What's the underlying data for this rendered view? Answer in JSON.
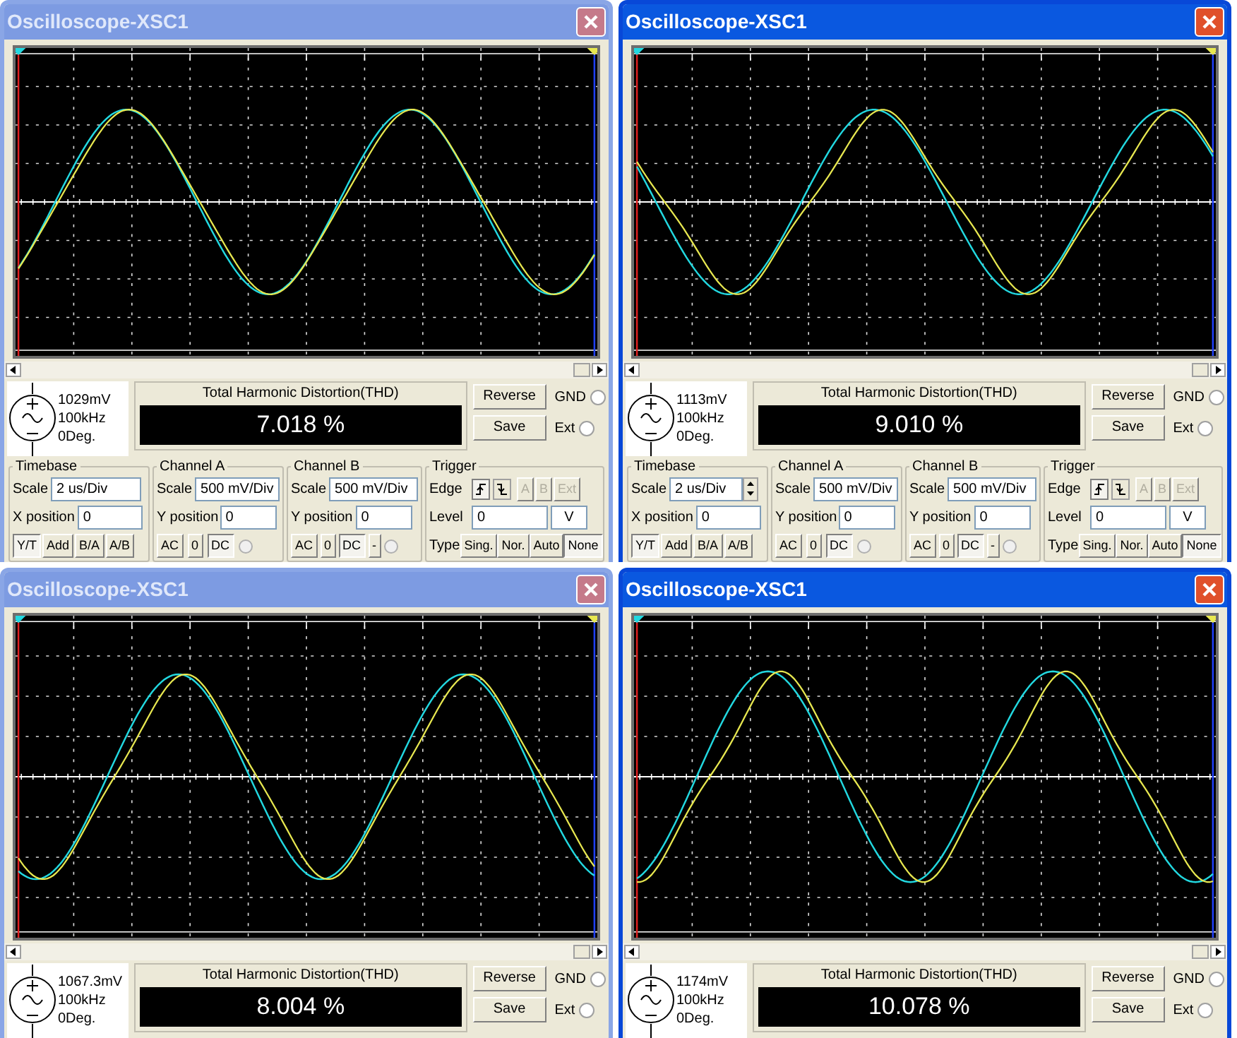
{
  "windows": [
    {
      "title": "Oscilloscope-XSC1",
      "active": false,
      "generator": {
        "amplitude": "1029mV",
        "frequency": "100kHz",
        "phase": "0Deg."
      },
      "thd_label": "Total Harmonic Distortion(THD)",
      "thd_value": "7.018 %",
      "buttons": [
        "Reverse",
        "Save"
      ],
      "radios": [
        {
          "label": "GND",
          "selected": false
        },
        {
          "label": "Ext",
          "selected": false
        }
      ],
      "controls": {
        "timebase": {
          "title": "Timebase",
          "scale_label": "Scale",
          "scale": "2 us/Div",
          "spinner": false,
          "xpos_label": "X position",
          "xpos": "0",
          "modes": [
            {
              "label": "Y/T",
              "selected": true
            },
            {
              "label": "Add",
              "selected": false
            },
            {
              "label": "B/A",
              "selected": false
            },
            {
              "label": "A/B",
              "selected": false
            }
          ]
        },
        "channel_a": {
          "title": "Channel A",
          "scale_label": "Scale",
          "scale": "500 mV/Div",
          "ypos_label": "Y position",
          "ypos": "0",
          "coupling": [
            {
              "label": "AC",
              "selected": false
            },
            {
              "label": "0",
              "selected": false
            },
            {
              "label": "DC",
              "selected": true
            }
          ]
        },
        "channel_b": {
          "title": "Channel B",
          "scale_label": "Scale",
          "scale": "500 mV/Div",
          "ypos_label": "Y position",
          "ypos": "0",
          "coupling": [
            {
              "label": "AC",
              "selected": false
            },
            {
              "label": "0",
              "selected": false
            },
            {
              "label": "DC",
              "selected": true
            },
            {
              "label": "-",
              "selected": false
            }
          ]
        },
        "trigger": {
          "title": "Trigger",
          "edge_label": "Edge",
          "sources": [
            {
              "label": "A",
              "disabled": true
            },
            {
              "label": "B",
              "disabled": true
            },
            {
              "label": "Ext",
              "disabled": true
            }
          ],
          "level_label": "Level",
          "level": "0",
          "unit": "V",
          "type_label": "Type",
          "types": [
            {
              "label": "Sing.",
              "selected": false
            },
            {
              "label": "Nor.",
              "selected": false
            },
            {
              "label": "Auto",
              "selected": false
            },
            {
              "label": "None",
              "selected": true
            }
          ]
        }
      }
    },
    {
      "title": "Oscilloscope-XSC1",
      "active": true,
      "generator": {
        "amplitude": "1113mV",
        "frequency": "100kHz",
        "phase": "0Deg."
      },
      "thd_label": "Total Harmonic Distortion(THD)",
      "thd_value": "9.010 %",
      "buttons": [
        "Reverse",
        "Save"
      ],
      "radios": [
        {
          "label": "GND",
          "selected": false
        },
        {
          "label": "Ext",
          "selected": false
        }
      ],
      "controls": {
        "timebase": {
          "title": "Timebase",
          "scale_label": "Scale",
          "scale": "2 us/Div",
          "spinner": true,
          "xpos_label": "X position",
          "xpos": "0",
          "modes": [
            {
              "label": "Y/T",
              "selected": true
            },
            {
              "label": "Add",
              "selected": false
            },
            {
              "label": "B/A",
              "selected": false
            },
            {
              "label": "A/B",
              "selected": false
            }
          ]
        },
        "channel_a": {
          "title": "Channel A",
          "scale_label": "Scale",
          "scale": "500 mV/Div",
          "ypos_label": "Y position",
          "ypos": "0",
          "coupling": [
            {
              "label": "AC",
              "selected": false
            },
            {
              "label": "0",
              "selected": false
            },
            {
              "label": "DC",
              "selected": true
            }
          ]
        },
        "channel_b": {
          "title": "Channel B",
          "scale_label": "Scale",
          "scale": "500 mV/Div",
          "ypos_label": "Y position",
          "ypos": "0",
          "coupling": [
            {
              "label": "AC",
              "selected": false
            },
            {
              "label": "0",
              "selected": false
            },
            {
              "label": "DC",
              "selected": true
            },
            {
              "label": "-",
              "selected": false
            }
          ]
        },
        "trigger": {
          "title": "Trigger",
          "edge_label": "Edge",
          "sources": [
            {
              "label": "A",
              "disabled": true
            },
            {
              "label": "B",
              "disabled": true
            },
            {
              "label": "Ext",
              "disabled": true
            }
          ],
          "level_label": "Level",
          "level": "0",
          "unit": "V",
          "type_label": "Type",
          "types": [
            {
              "label": "Sing.",
              "selected": false
            },
            {
              "label": "Nor.",
              "selected": false
            },
            {
              "label": "Auto",
              "selected": false
            },
            {
              "label": "None",
              "selected": true
            }
          ]
        }
      }
    },
    {
      "title": "Oscilloscope-XSC1",
      "active": false,
      "generator": {
        "amplitude": "1067.3mV",
        "frequency": "100kHz",
        "phase": "0Deg."
      },
      "thd_label": "Total Harmonic Distortion(THD)",
      "thd_value": "8.004 %",
      "buttons": [
        "Reverse",
        "Save"
      ],
      "radios": [
        {
          "label": "GND",
          "selected": false
        },
        {
          "label": "Ext",
          "selected": false
        }
      ]
    },
    {
      "title": "Oscilloscope-XSC1",
      "active": true,
      "generator": {
        "amplitude": "1174mV",
        "frequency": "100kHz",
        "phase": "0Deg."
      },
      "thd_label": "Total Harmonic Distortion(THD)",
      "thd_value": "10.078 %",
      "buttons": [
        "Reverse",
        "Save"
      ],
      "radios": [
        {
          "label": "GND",
          "selected": false
        },
        {
          "label": "Ext",
          "selected": false
        }
      ]
    }
  ]
}
